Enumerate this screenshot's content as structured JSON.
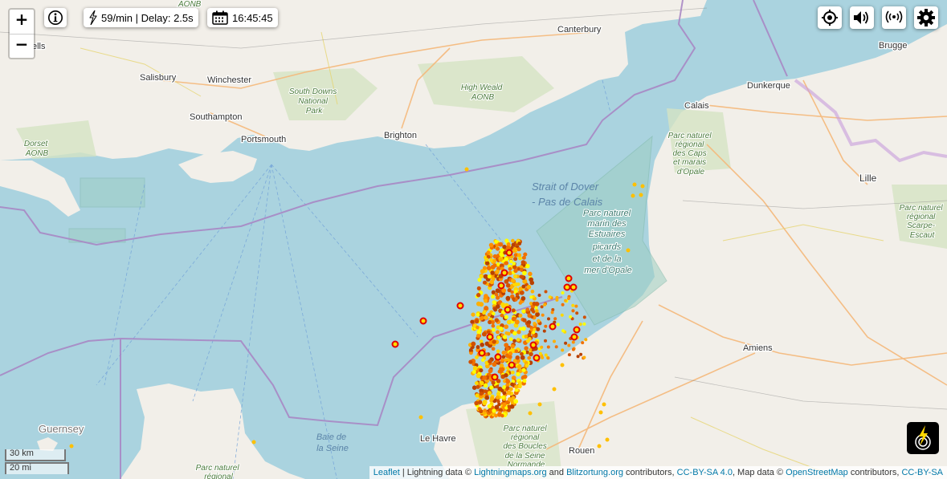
{
  "controls": {
    "zoom_in": "+",
    "zoom_out": "−",
    "rate_text": "59/min | Delay: 2.5s",
    "time_text": "16:45:45"
  },
  "places": {
    "canterbury": "Canterbury",
    "brugge": "Brugge",
    "salisbury": "Salisbury",
    "winchester": "Winchester",
    "dunkerque": "Dunkerque",
    "southampton": "Southampton",
    "calais": "Calais",
    "portsmouth": "Portsmouth",
    "brighton": "Brighton",
    "lille": "Lille",
    "le_havre": "Le Havre",
    "amiens": "Amiens",
    "rouen": "Rouen",
    "guernsey": "Guernsey",
    "wells": "ells",
    "aonb_top": "AONB"
  },
  "park_labels": {
    "south_downs": [
      "South Downs",
      "National",
      "Park"
    ],
    "high_weald": [
      "High Weald",
      "AONB"
    ],
    "dorset": [
      "Dorset",
      "AONB"
    ],
    "caps": [
      "Parc naturel",
      "régional",
      "des Caps",
      "et marais",
      "d'Opale"
    ],
    "scarpe": [
      "Parc naturel",
      "régional",
      "Scarpe-",
      "Escaut"
    ],
    "estuaires": [
      "Parc naturel",
      "marin des",
      "Estuaires",
      "picards",
      "et de la",
      "mer d'Opale"
    ],
    "boucles": [
      "Parc naturel",
      "régional",
      "des Boucles",
      "de la Seine",
      "Normande"
    ],
    "bottom_left": [
      "Parc naturel",
      "régional"
    ]
  },
  "water_labels": {
    "strait": [
      "Strait of Dover",
      "- Pas de Calais"
    ],
    "baie": [
      "Baie de",
      "la Seine"
    ]
  },
  "scale": {
    "km": "30 km",
    "mi": "20 mi"
  },
  "attribution": {
    "leaflet": "Leaflet",
    "sep1": " | Lightning data © ",
    "lm": "Lightningmaps.org",
    "and": " and ",
    "bo": "Blitzortung.org",
    "contrib": " contributors, ",
    "cc1": "CC-BY-SA 4.0",
    "mapdata": ", Map data © ",
    "osm": "OpenStreetMap",
    "contrib2": " contributors, ",
    "cc2": "CC-BY-SA"
  },
  "colors": {
    "sea": "#aad3df",
    "land": "#f2efe9",
    "border": "#a987c4",
    "strike_recent": "#ffff00",
    "strike_old": "#c04000",
    "strike_ring": "#e00000"
  }
}
